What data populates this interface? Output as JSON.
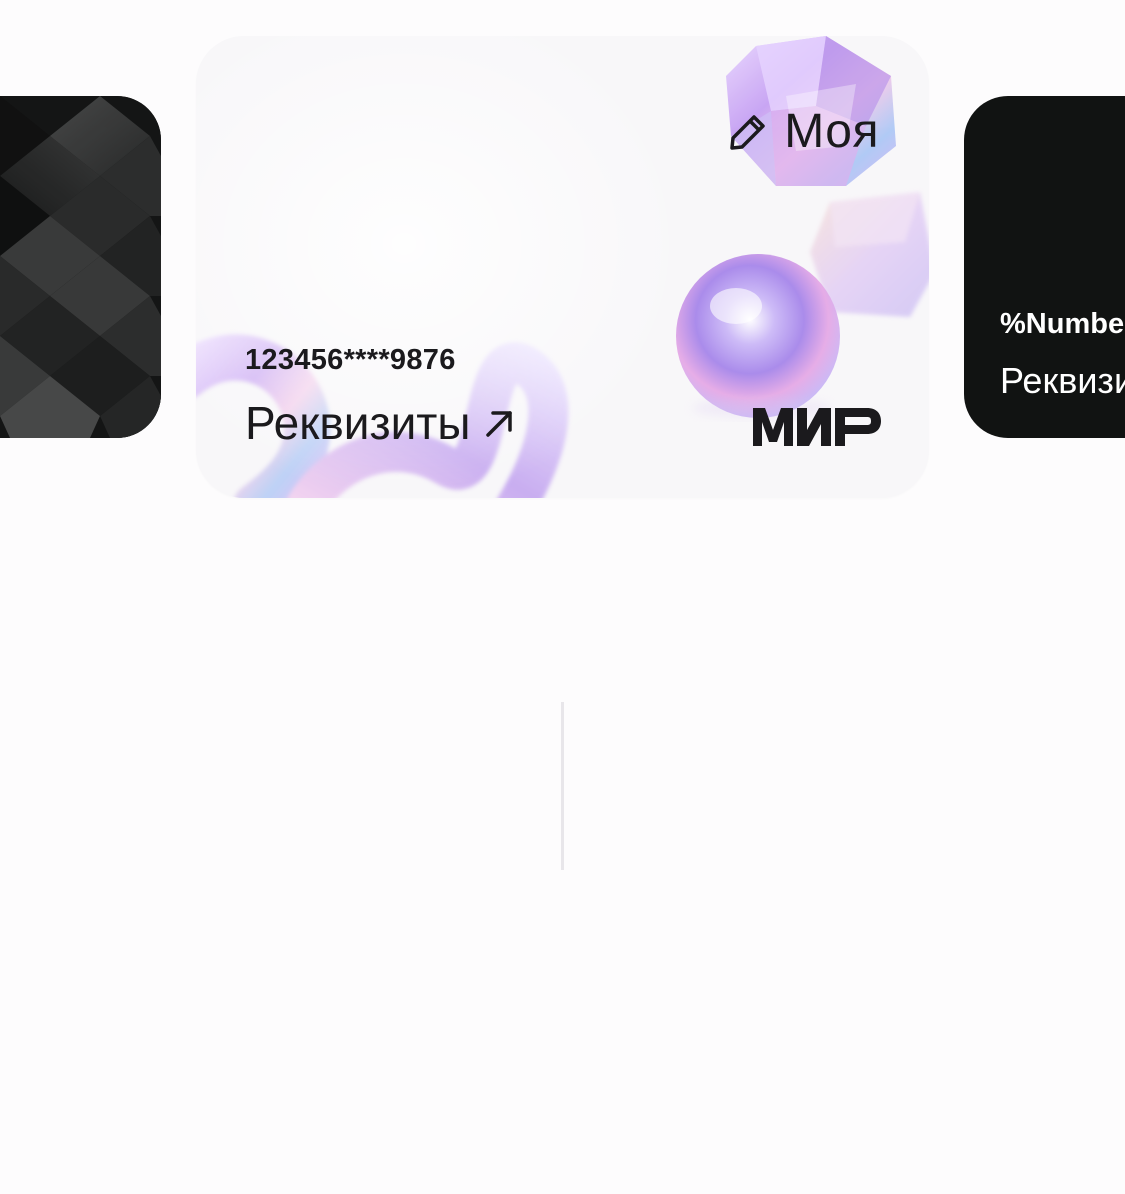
{
  "cards": {
    "previous": {
      "style": "dark-geometric"
    },
    "current": {
      "name": "Моя",
      "name_edit_icon": "pencil-icon",
      "number": "123456****9876",
      "requisites_label": "Реквизиты",
      "requisites_icon": "arrow-up-right-icon",
      "payment_system": "МИР",
      "background": "iridescent-3d-shapes"
    },
    "next": {
      "number": "%Number%",
      "requisites_label": "Реквизиты",
      "background_color": "#111312"
    }
  },
  "colors": {
    "text_primary": "#1b1a1d",
    "card_light_bg": "#f8f7f9",
    "card_dark_bg": "#111312",
    "iridescent_accent": "#c7a6f0"
  }
}
